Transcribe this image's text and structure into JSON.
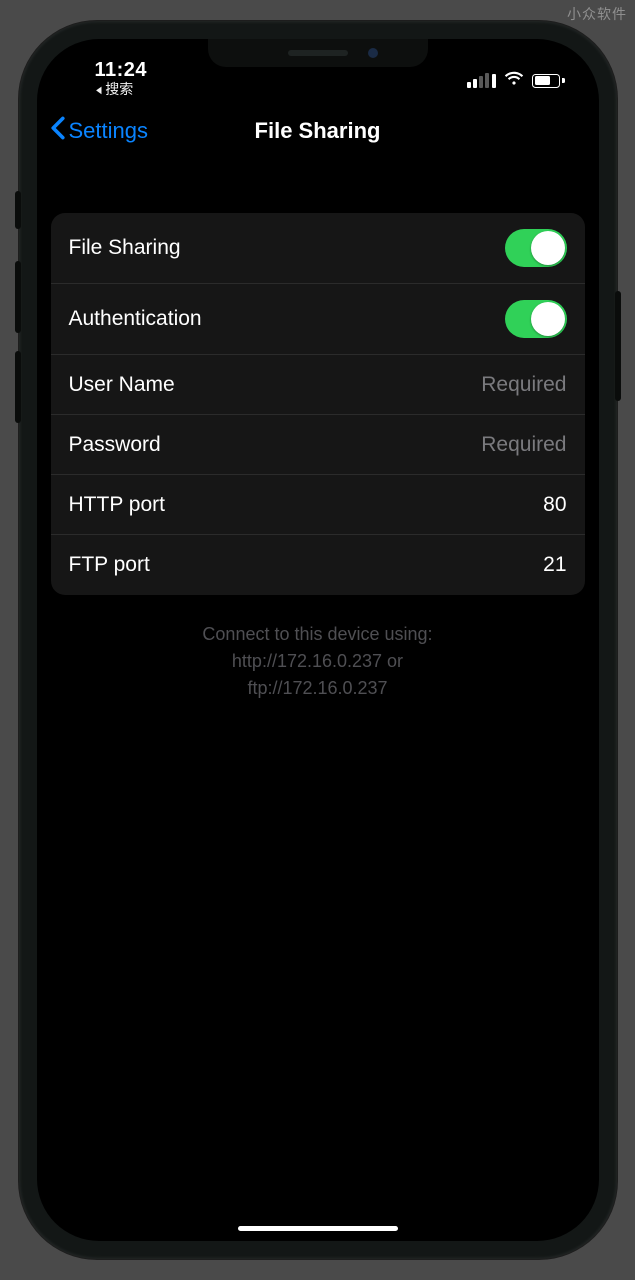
{
  "watermark": "小众软件",
  "status": {
    "time": "11:24",
    "back_to": "搜索"
  },
  "nav": {
    "back_label": "Settings",
    "title": "File Sharing"
  },
  "rows": {
    "file_sharing": {
      "label": "File Sharing",
      "on": true
    },
    "authentication": {
      "label": "Authentication",
      "on": true
    },
    "username": {
      "label": "User Name",
      "placeholder": "Required"
    },
    "password": {
      "label": "Password",
      "placeholder": "Required"
    },
    "http_port": {
      "label": "HTTP port",
      "value": "80"
    },
    "ftp_port": {
      "label": "FTP port",
      "value": "21"
    }
  },
  "footer": {
    "line1": "Connect to this device using:",
    "line2": "http://172.16.0.237 or",
    "line3": "ftp://172.16.0.237"
  }
}
